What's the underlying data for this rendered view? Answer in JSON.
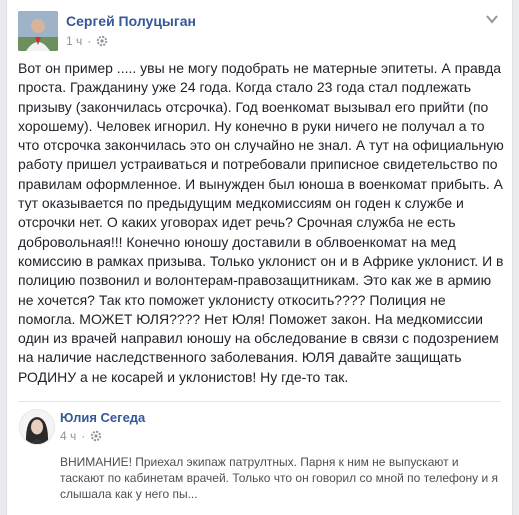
{
  "post": {
    "author": "Сергей Полуцыган",
    "time": "1 ч",
    "text": "Вот он пример ..... увы не могу подобрать не матерные эпитеты. А правда проста. Гражданину уже 24 года. Когда стало 23 года стал подлежать призыву (закончилась отсрочка). Год военкомат вызывал его прийти (по хорошему). Человек игнорил. Ну конечно в руки ничего не получал а то что отсрочка закончилась это он случайно не знал. А тут на официальную работу пришел устраиваться и потребовали приписное свидетельство по правилам оформленное. И вынужден был юноша в военкомат прибыть. А тут оказывается по предыдущим медкомиссиям он годен к службе и отсрочки нет. О каких уговорах идет речь? Срочная служба не есть добровольная!!! Конечно юношу доставили в облвоенкомат на мед комиссию в рамках призыва. Только уклонист он и в Африке уклонист. И в полицию позвонил и волонтерам-правозащитникам. Это как же в армию не хочется? Так кто поможет уклонисту откосить???? Полиция не помогла. МОЖЕТ ЮЛЯ???? Нет Юля! Поможет закон. На медкомиссии один из врачей направил юношу на обследование в связи с подозрением на наличие наследственного заболевания. ЮЛЯ давайте защищать РОДИНУ а не косарей и уклонистов! Ну где-то так."
  },
  "shared": {
    "author": "Юлия Сегеда",
    "time": "4 ч",
    "text": "ВНИМАНИЕ! Приехал экипаж патрултных. Парня к ним не выпускают и таскают по кабинетам врачей. Только что он говорил со мной по телефону и я слышала как у него пы..."
  },
  "colors": {
    "link": "#365899",
    "meta": "#90949c",
    "text": "#1d2129"
  },
  "icons": {
    "privacy": "gear-icon",
    "menu": "chevron-down-icon"
  }
}
